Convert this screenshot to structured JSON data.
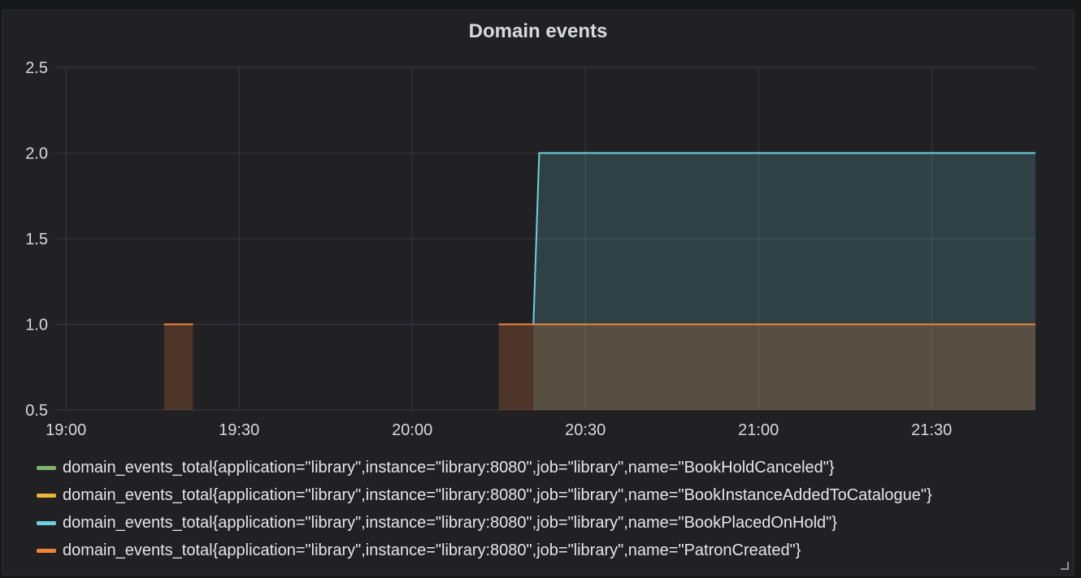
{
  "panel": {
    "title": "Domain events"
  },
  "chart_data": {
    "type": "area",
    "title": "Domain events",
    "x_ticks": [
      "19:00",
      "19:30",
      "20:00",
      "20:30",
      "21:00",
      "21:30"
    ],
    "y_ticks": [
      "0.5",
      "1.0",
      "1.5",
      "2.0",
      "2.5"
    ],
    "ylim": [
      0.5,
      2.5
    ],
    "xlim": [
      "18:58",
      "21:48"
    ],
    "grid": true,
    "legend_position": "bottom",
    "series": [
      {
        "name": "domain_events_total{application=\"library\",instance=\"library:8080\",job=\"library\",name=\"BookHoldCanceled\"}",
        "color": "#7eb26d",
        "points": []
      },
      {
        "name": "domain_events_total{application=\"library\",instance=\"library:8080\",job=\"library\",name=\"BookInstanceAddedToCatalogue\"}",
        "color": "#eab839",
        "points": []
      },
      {
        "name": "domain_events_total{application=\"library\",instance=\"library:8080\",job=\"library\",name=\"BookPlacedOnHold\"}",
        "color": "#6ed0e0",
        "points": [
          {
            "x": "20:21",
            "y": 1
          },
          {
            "x": "20:22",
            "y": 2
          },
          {
            "x": "21:48",
            "y": 2
          }
        ]
      },
      {
        "name": "domain_events_total{application=\"library\",instance=\"library:8080\",job=\"library\",name=\"PatronCreated\"}",
        "color": "#ef843c",
        "segments": [
          {
            "start": "19:17",
            "end": "19:22",
            "y": 1
          },
          {
            "start": "20:15",
            "end": "21:48",
            "y": 1
          }
        ]
      }
    ]
  }
}
